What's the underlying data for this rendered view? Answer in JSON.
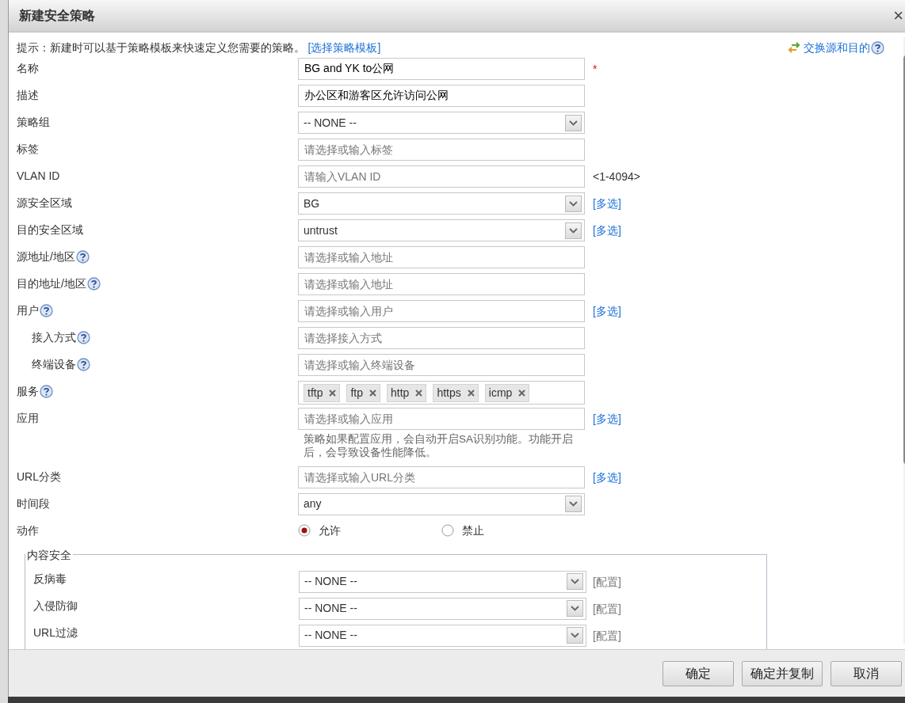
{
  "dialog": {
    "title": "新建安全策略",
    "close": "×"
  },
  "hint": {
    "text": "提示：新建时可以基于策略模板来快速定义您需要的策略。",
    "link": "[选择策略模板]"
  },
  "swap_link": "交换源和目的",
  "fields": [
    {
      "label": "名称",
      "kind": "text",
      "value": "BG and YK to公网",
      "required_mark": "*"
    },
    {
      "label": "描述",
      "kind": "text",
      "value": "办公区和游客区允许访问公网"
    },
    {
      "label": "策略组",
      "kind": "select",
      "value": "-- NONE --"
    },
    {
      "label": "标签",
      "kind": "text",
      "placeholder": "请选择或输入标签"
    },
    {
      "label": "VLAN ID",
      "kind": "text",
      "placeholder": "请输入VLAN ID",
      "suffix": "<1-4094>"
    },
    {
      "label": "源安全区域",
      "kind": "select",
      "value": "BG",
      "link": "[多选]"
    },
    {
      "label": "目的安全区域",
      "kind": "select",
      "value": "untrust",
      "link": "[多选]"
    },
    {
      "label": "源地址/地区",
      "help": true,
      "kind": "text",
      "placeholder": "请选择或输入地址"
    },
    {
      "label": "目的地址/地区",
      "help": true,
      "kind": "text",
      "placeholder": "请选择或输入地址"
    },
    {
      "label": "用户",
      "help": true,
      "kind": "text",
      "placeholder": "请选择或输入用户",
      "link": "[多选]",
      "children": [
        {
          "label": "接入方式",
          "help": true,
          "kind": "text",
          "placeholder": "请选择接入方式"
        },
        {
          "label": "终端设备",
          "help": true,
          "kind": "text",
          "placeholder": "请选择或输入终端设备"
        }
      ]
    },
    {
      "label": "服务",
      "help": true,
      "kind": "tags",
      "tags": [
        "tftp",
        "ftp",
        "http",
        "https",
        "icmp"
      ]
    },
    {
      "label": "应用",
      "kind": "text",
      "placeholder": "请选择或输入应用",
      "link": "[多选]",
      "note": "策略如果配置应用，会自动开启SA识别功能。功能开启后，会导致设备性能降低。"
    },
    {
      "label": "URL分类",
      "kind": "text",
      "placeholder": "请选择或输入URL分类",
      "link": "[多选]"
    },
    {
      "label": "时间段",
      "kind": "select",
      "value": "any"
    },
    {
      "label": "动作",
      "kind": "radio",
      "options": [
        {
          "label": "允许",
          "selected": true
        },
        {
          "label": "禁止",
          "selected": false
        }
      ]
    }
  ],
  "content_security": {
    "title": "内容安全",
    "rows": [
      {
        "label": "反病毒",
        "value": "-- NONE --",
        "link": "[配置]"
      },
      {
        "label": "入侵防御",
        "value": "-- NONE --",
        "link": "[配置]"
      },
      {
        "label": "URL过滤",
        "value": "-- NONE --",
        "link": "[配置]"
      }
    ]
  },
  "buttons": [
    "确定",
    "确定并复制",
    "取消"
  ]
}
